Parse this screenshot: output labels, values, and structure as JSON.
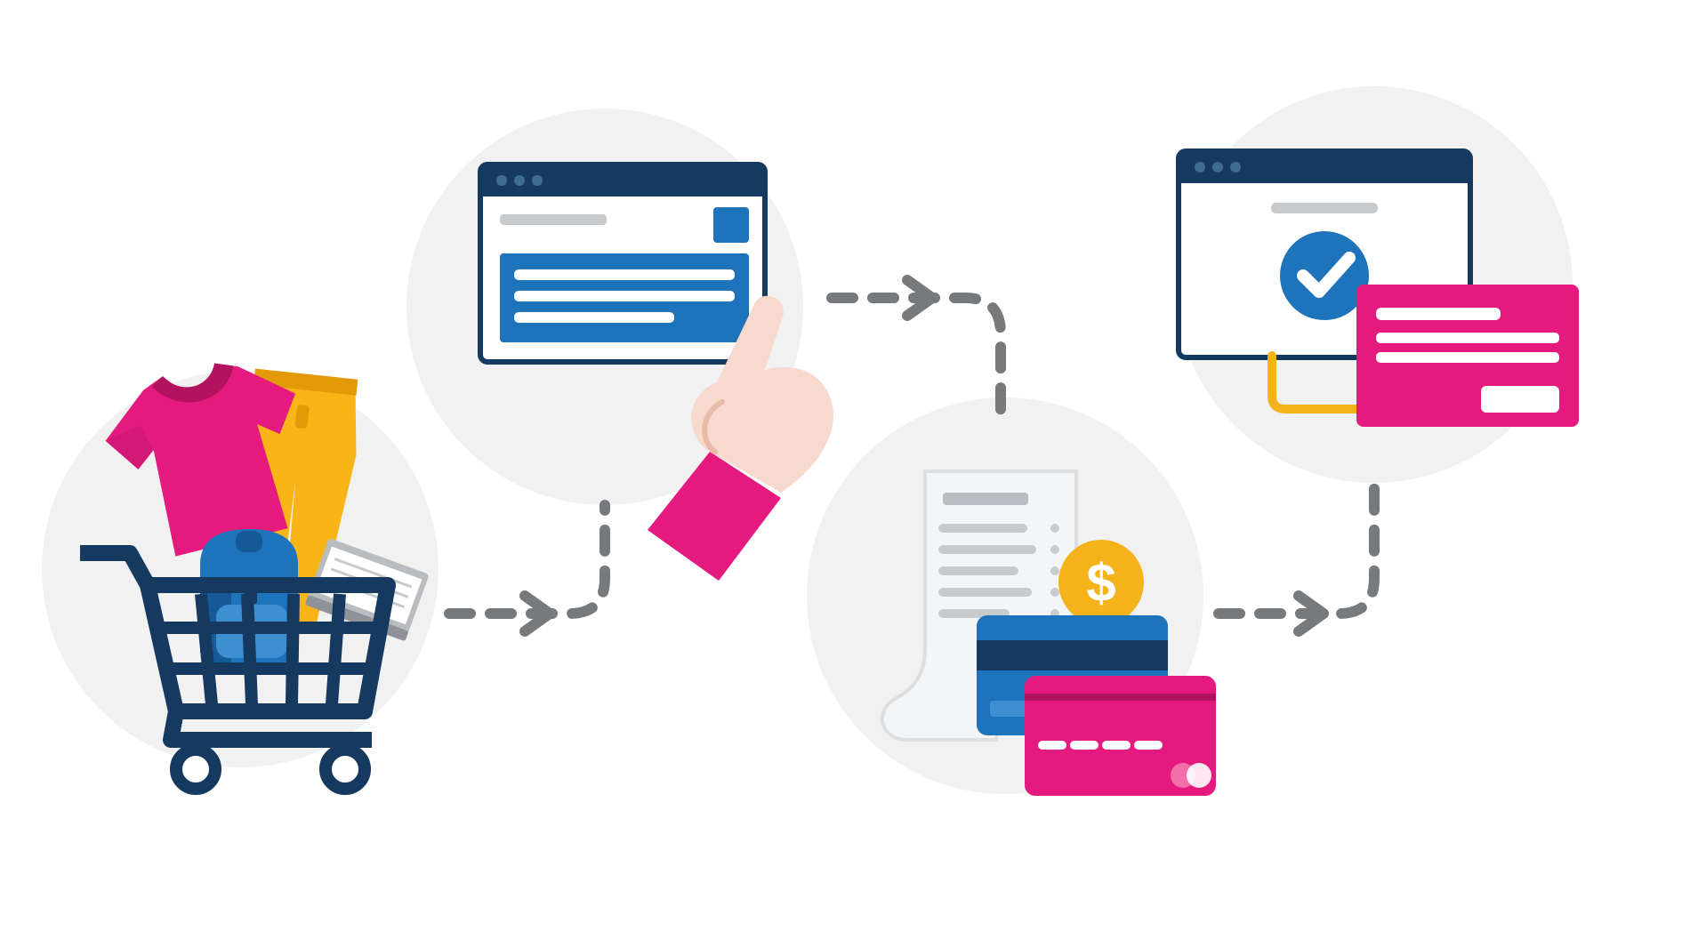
{
  "title": "E-commerce checkout flow",
  "colors": {
    "circle_bg": "#F1F1F2",
    "navy": "#163A5F",
    "blue": "#1E74BB",
    "magenta": "#E41A7F",
    "yellow": "#F9B418",
    "gold": "#F4B21B",
    "grey_line": "#777A7D",
    "grey_soft": "#C8CBCE",
    "grey_light": "#E3E5E7",
    "skin": "#F8D9CE",
    "white": "#FFFFFF"
  },
  "steps": [
    {
      "id": "cart",
      "label": "Shopping cart with products",
      "items": [
        "t-shirt",
        "pants",
        "backpack",
        "book"
      ]
    },
    {
      "id": "form",
      "label": "Checkout form / browser",
      "action": "click"
    },
    {
      "id": "payment",
      "label": "Invoice and payment cards",
      "currency": "$"
    },
    {
      "id": "confirm",
      "label": "Order confirmation"
    }
  ],
  "arrows": [
    {
      "from": "cart",
      "to": "form"
    },
    {
      "from": "form",
      "to": "payment"
    },
    {
      "from": "payment",
      "to": "confirm"
    }
  ]
}
